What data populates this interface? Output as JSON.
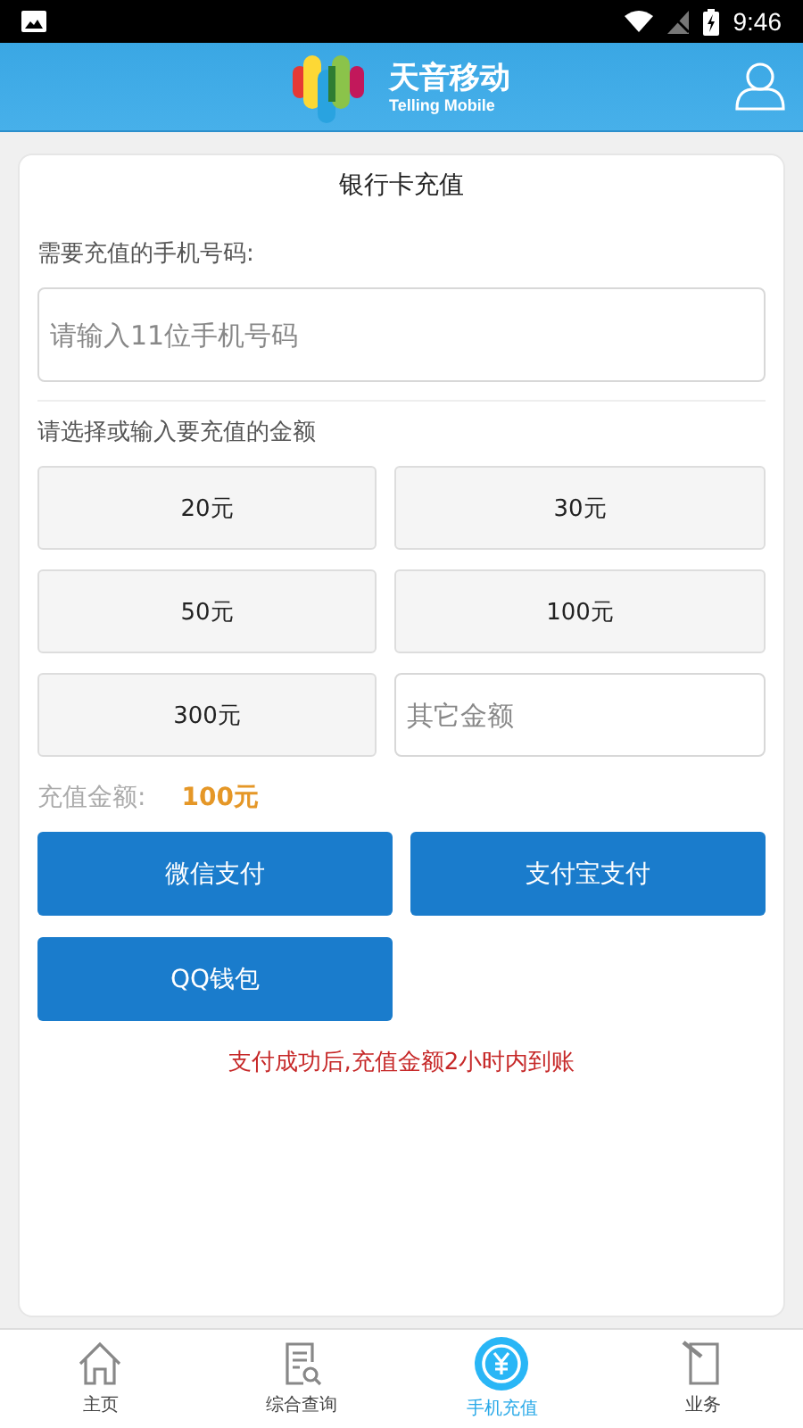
{
  "status_bar": {
    "time": "9:46"
  },
  "header": {
    "brand": "天音移动",
    "brand_en": "Telling Mobile"
  },
  "card": {
    "title": "银行卡充值",
    "phone_label": "需要充值的手机号码:",
    "phone_field": {
      "placeholder": "请输入11位手机号码"
    },
    "amount_label": "请选择或输入要充值的金额",
    "amounts": [
      {
        "label": "20元",
        "kind": "button"
      },
      {
        "label": "30元",
        "kind": "button"
      },
      {
        "label": "50元",
        "kind": "button"
      },
      {
        "label": "100元",
        "kind": "button"
      },
      {
        "label": "300元",
        "kind": "button"
      },
      {
        "placeholder": "其它金额",
        "kind": "field"
      }
    ],
    "total_label": "充值金额:",
    "total_value": "100元",
    "payments": [
      "微信支付",
      "支付宝支付",
      "QQ钱包"
    ],
    "note": "支付成功后,充值金额2小时内到账"
  },
  "nav": [
    {
      "label": "主页",
      "kind": "home",
      "selected": false
    },
    {
      "label": "综合查询",
      "kind": "query",
      "selected": false
    },
    {
      "label": "手机充值",
      "kind": "recharge",
      "selected": true
    },
    {
      "label": "业务",
      "kind": "business",
      "selected": false
    }
  ]
}
